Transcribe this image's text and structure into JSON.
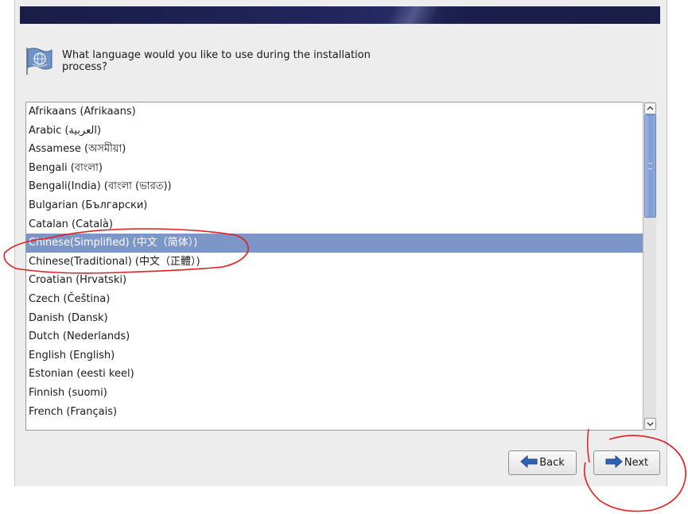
{
  "question": "What language would you like to use during the installation process?",
  "languages": [
    "Afrikaans (Afrikaans)",
    "Arabic (العربية)",
    "Assamese (অসমীয়া)",
    "Bengali (বাংলা)",
    "Bengali(India) (বাংলা (ভারত))",
    "Bulgarian (Български)",
    "Catalan (Català)",
    "Chinese(Simplified) (中文（简体）)",
    "Chinese(Traditional) (中文（正體）)",
    "Croatian (Hrvatski)",
    "Czech (Čeština)",
    "Danish (Dansk)",
    "Dutch (Nederlands)",
    "English (English)",
    "Estonian (eesti keel)",
    "Finnish (suomi)",
    "French (Français)"
  ],
  "selected_index": 7,
  "buttons": {
    "back": "Back",
    "next": "Next"
  },
  "icons": {
    "globe": "globe-flag-icon",
    "back_arrow": "arrow-left-icon",
    "next_arrow": "arrow-right-icon",
    "scroll_up": "chevron-up-icon",
    "scroll_down": "chevron-down-icon"
  },
  "colors": {
    "banner": "#1a1d45",
    "selection": "#7c96c8",
    "arrow_blue": "#2f63b8",
    "annotation_red": "#e02020"
  }
}
